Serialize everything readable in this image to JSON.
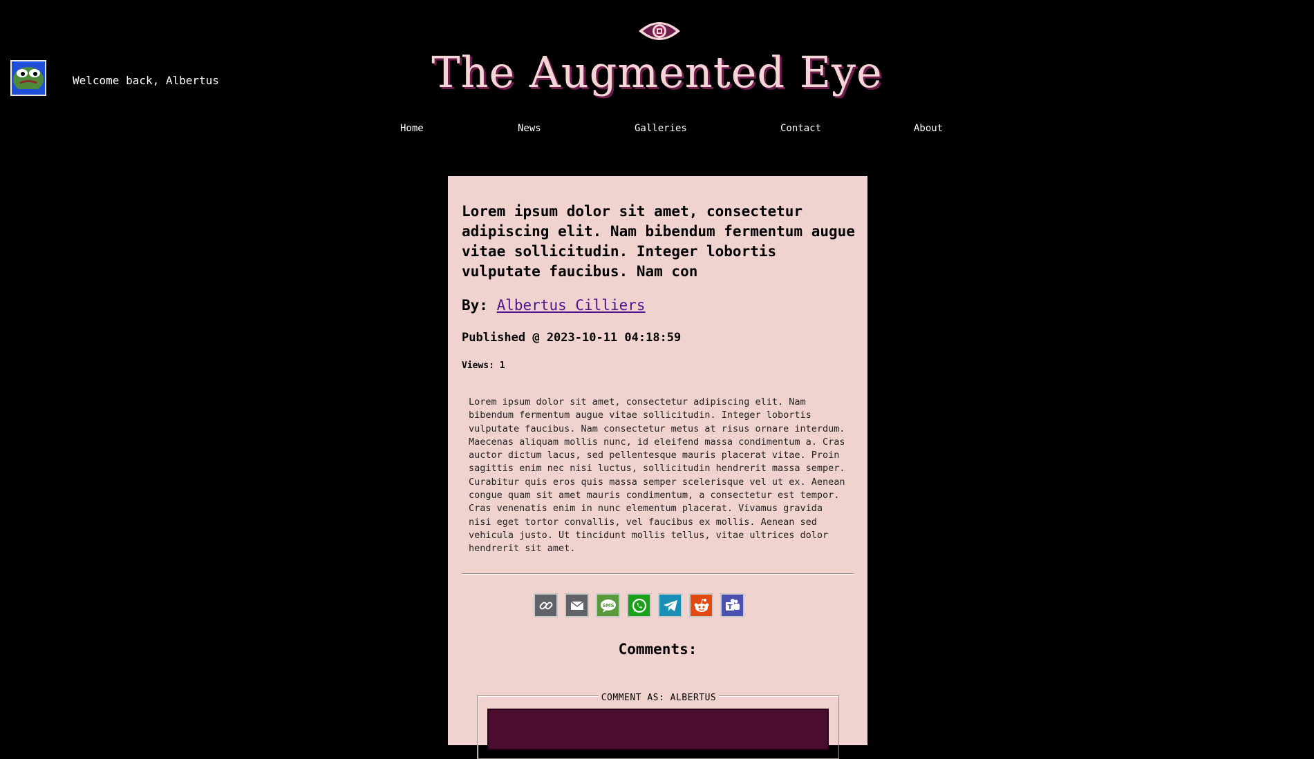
{
  "header": {
    "welcome": "Welcome back, Albertus",
    "site_title": "The Augmented Eye"
  },
  "nav": {
    "items": [
      "Home",
      "News",
      "Galleries",
      "Contact",
      "About"
    ]
  },
  "article": {
    "headline": "Lorem ipsum dolor sit amet, consectetur adipiscing elit. Nam bibendum fermentum augue vitae sollicitudin. Integer lobortis vulputate faucibus. Nam con",
    "by_label": "By:",
    "author": "Albertus Cilliers",
    "published": "Published @ 2023-10-11 04:18:59",
    "views": "Views: 1",
    "body": "Lorem ipsum dolor sit amet, consectetur adipiscing elit. Nam bibendum fermentum augue vitae sollicitudin. Integer lobortis vulputate faucibus. Nam consectetur metus at risus ornare interdum. Maecenas aliquam mollis nunc, id eleifend massa condimentum a. Cras auctor dictum lacus, sed pellentesque mauris placerat vitae. Proin sagittis enim nec nisi luctus, sollicitudin hendrerit massa semper. Curabitur quis eros quis massa semper scelerisque vel ut ex. Aenean congue quam sit amet mauris condimentum, a consectetur est tempor. Cras venenatis enim in nunc elementum placerat. Vivamus gravida nisi eget tortor convallis, vel faucibus ex mollis. Aenean sed vehicula justo. Ut tincidunt mollis tellus, vitae ultrices dolor hendrerit sit amet."
  },
  "share_buttons": [
    {
      "icon": "link-icon",
      "color": "#5f6368"
    },
    {
      "icon": "email-icon",
      "color": "#5f6368"
    },
    {
      "icon": "sms-icon",
      "color": "#5a9a3c"
    },
    {
      "icon": "whatsapp-icon",
      "color": "#1aa11a"
    },
    {
      "icon": "telegram-icon",
      "color": "#1a8fb3"
    },
    {
      "icon": "reddit-icon",
      "color": "#e04a10"
    },
    {
      "icon": "teams-icon",
      "color": "#4b4fb0"
    }
  ],
  "comments": {
    "title": "Comments:",
    "legend": "COMMENT AS: ALBERTUS",
    "input_value": ""
  }
}
